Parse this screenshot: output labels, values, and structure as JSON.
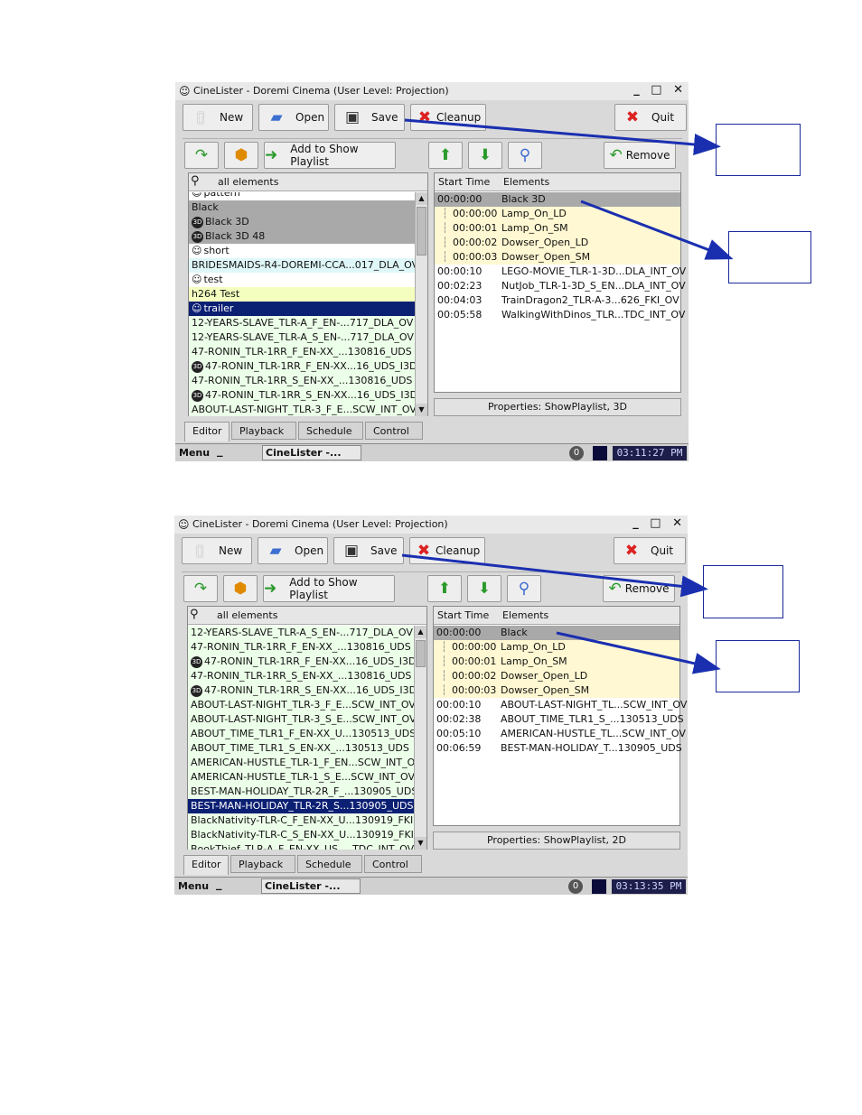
{
  "shots": [
    {
      "title": "CineLister - Doremi Cinema (User Level: Projection)",
      "toolbar": {
        "new": "New",
        "open": "Open",
        "save": "Save",
        "cleanup": "Cleanup",
        "quit": "Quit"
      },
      "actions": {
        "add": "Add to Show Playlist",
        "remove": "Remove"
      },
      "search": "all elements",
      "list": [
        {
          "t": "pattern",
          "s": "white",
          "i": "film"
        },
        {
          "t": "Black",
          "s": "gray",
          "i": ""
        },
        {
          "t": "Black 3D",
          "s": "gray",
          "i": "3d"
        },
        {
          "t": "Black 3D 48",
          "s": "gray",
          "i": "3d"
        },
        {
          "t": "short",
          "s": "white",
          "i": "film"
        },
        {
          "t": "BRIDESMAIDS-R4-DOREMI-CCA...017_DLA_OV",
          "s": "cyan",
          "i": ""
        },
        {
          "t": "test",
          "s": "white",
          "i": "film"
        },
        {
          "t": "h264 Test",
          "s": "yellow",
          "i": ""
        },
        {
          "t": "trailer",
          "s": "navy",
          "i": "film"
        },
        {
          "t": "12-YEARS-SLAVE_TLR-A_F_EN-...717_DLA_OV",
          "s": "green",
          "i": ""
        },
        {
          "t": "12-YEARS-SLAVE_TLR-A_S_EN-...717_DLA_OV",
          "s": "green",
          "i": ""
        },
        {
          "t": "47-RONIN_TLR-1RR_F_EN-XX_...130816_UDS",
          "s": "green",
          "i": ""
        },
        {
          "t": "47-RONIN_TLR-1RR_F_EN-XX...16_UDS_I3D",
          "s": "green",
          "i": "3d"
        },
        {
          "t": "47-RONIN_TLR-1RR_S_EN-XX_...130816_UDS",
          "s": "green",
          "i": ""
        },
        {
          "t": "47-RONIN_TLR-1RR_S_EN-XX...16_UDS_I3D",
          "s": "green",
          "i": "3d"
        },
        {
          "t": "ABOUT-LAST-NIGHT_TLR-3_F_E...SCW_INT_OV",
          "s": "green",
          "i": ""
        }
      ],
      "headers": {
        "start": "Start Time",
        "elements": "Elements"
      },
      "playlist": [
        {
          "t": "00:00:00",
          "e": "Black 3D",
          "k": "sel"
        },
        {
          "t": "00:00:00",
          "e": "Lamp_On_LD",
          "k": "sub"
        },
        {
          "t": "00:00:01",
          "e": "Lamp_On_SM",
          "k": "sub"
        },
        {
          "t": "00:00:02",
          "e": "Dowser_Open_LD",
          "k": "sub"
        },
        {
          "t": "00:00:03",
          "e": "Dowser_Open_SM",
          "k": "sub"
        },
        {
          "t": "00:00:10",
          "e": "LEGO-MOVIE_TLR-1-3D...DLA_INT_OV",
          "k": "main"
        },
        {
          "t": "00:02:23",
          "e": "NutJob_TLR-1-3D_S_EN...DLA_INT_OV",
          "k": "main"
        },
        {
          "t": "00:04:03",
          "e": "TrainDragon2_TLR-A-3...626_FKI_OV",
          "k": "main"
        },
        {
          "t": "00:05:58",
          "e": "WalkingWithDinos_TLR...TDC_INT_OV",
          "k": "main"
        }
      ],
      "properties": "Properties: ShowPlaylist, 3D",
      "tabs": [
        "Editor",
        "Playback",
        "Schedule",
        "Control"
      ],
      "taskbar": {
        "menu": "Menu",
        "task": "CineLister -...",
        "badge": "0",
        "clock": "03:11:27 PM"
      }
    },
    {
      "title": "CineLister - Doremi Cinema (User Level: Projection)",
      "toolbar": {
        "new": "New",
        "open": "Open",
        "save": "Save",
        "cleanup": "Cleanup",
        "quit": "Quit"
      },
      "actions": {
        "add": "Add to Show Playlist",
        "remove": "Remove"
      },
      "search": "all elements",
      "list": [
        {
          "t": "12-YEARS-SLAVE_TLR-A_S_EN-...717_DLA_OV",
          "s": "green",
          "i": ""
        },
        {
          "t": "47-RONIN_TLR-1RR_F_EN-XX_...130816_UDS",
          "s": "green",
          "i": ""
        },
        {
          "t": "47-RONIN_TLR-1RR_F_EN-XX...16_UDS_I3D",
          "s": "green",
          "i": "3d"
        },
        {
          "t": "47-RONIN_TLR-1RR_S_EN-XX_...130816_UDS",
          "s": "green",
          "i": ""
        },
        {
          "t": "47-RONIN_TLR-1RR_S_EN-XX...16_UDS_I3D",
          "s": "green",
          "i": "3d"
        },
        {
          "t": "ABOUT-LAST-NIGHT_TLR-3_F_E...SCW_INT_OV",
          "s": "green",
          "i": ""
        },
        {
          "t": "ABOUT-LAST-NIGHT_TLR-3_S_E...SCW_INT_OV",
          "s": "green",
          "i": ""
        },
        {
          "t": "ABOUT_TIME_TLR1_F_EN-XX_U...130513_UDS",
          "s": "green",
          "i": ""
        },
        {
          "t": "ABOUT_TIME_TLR1_S_EN-XX_...130513_UDS",
          "s": "green",
          "i": ""
        },
        {
          "t": "AMERICAN-HUSTLE_TLR-1_F_EN...SCW_INT_OV",
          "s": "green",
          "i": ""
        },
        {
          "t": "AMERICAN-HUSTLE_TLR-1_S_E...SCW_INT_OV",
          "s": "green",
          "i": ""
        },
        {
          "t": "BEST-MAN-HOLIDAY_TLR-2R_F_...130905_UDS",
          "s": "green",
          "i": ""
        },
        {
          "t": "BEST-MAN-HOLIDAY_TLR-2R_S...130905_UDS",
          "s": "navy",
          "i": ""
        },
        {
          "t": "BlackNativity-TLR-C_F_EN-XX_U...130919_FKI",
          "s": "green",
          "i": ""
        },
        {
          "t": "BlackNativity-TLR-C_S_EN-XX_U...130919_FKI",
          "s": "green",
          "i": ""
        },
        {
          "t": "BookThief_TLR-A_F_EN-XX_US_...TDC_INT_OV",
          "s": "green",
          "i": ""
        }
      ],
      "headers": {
        "start": "Start Time",
        "elements": "Elements"
      },
      "playlist": [
        {
          "t": "00:00:00",
          "e": "Black",
          "k": "sel"
        },
        {
          "t": "00:00:00",
          "e": "Lamp_On_LD",
          "k": "sub"
        },
        {
          "t": "00:00:01",
          "e": "Lamp_On_SM",
          "k": "sub"
        },
        {
          "t": "00:00:02",
          "e": "Dowser_Open_LD",
          "k": "sub"
        },
        {
          "t": "00:00:03",
          "e": "Dowser_Open_SM",
          "k": "sub"
        },
        {
          "t": "00:00:10",
          "e": "ABOUT-LAST-NIGHT_TL...SCW_INT_OV",
          "k": "main"
        },
        {
          "t": "00:02:38",
          "e": "ABOUT_TIME_TLR1_S_...130513_UDS",
          "k": "main"
        },
        {
          "t": "00:05:10",
          "e": "AMERICAN-HUSTLE_TL...SCW_INT_OV",
          "k": "main"
        },
        {
          "t": "00:06:59",
          "e": "BEST-MAN-HOLIDAY_T...130905_UDS",
          "k": "main"
        }
      ],
      "properties": "Properties: ShowPlaylist, 2D",
      "tabs": [
        "Editor",
        "Playback",
        "Schedule",
        "Control"
      ],
      "taskbar": {
        "menu": "Menu",
        "task": "CineLister -...",
        "badge": "0",
        "clock": "03:13:35 PM"
      }
    }
  ],
  "colors": {
    "row_gray": "#a9a9a9",
    "row_cyan": "#dff7f8",
    "row_yellow": "#f4ffbf",
    "row_green": "#ecffe9",
    "row_navy": "#0b1f73",
    "arrow": "#1a2fb0"
  },
  "icons": [
    "new-icon",
    "open-icon",
    "save-icon",
    "cleanup-icon",
    "quit-icon",
    "refresh-icon",
    "delete-icon",
    "add-icon",
    "up-icon",
    "down-icon",
    "find-icon",
    "remove-icon",
    "search-icon"
  ]
}
